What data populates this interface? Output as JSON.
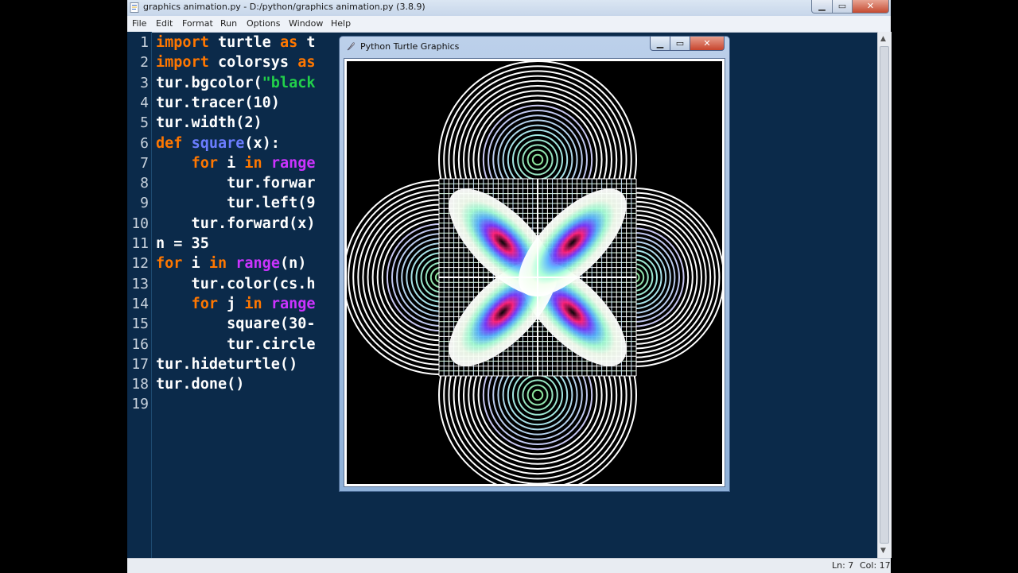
{
  "idle_window": {
    "title": "graphics animation.py - D:/python/graphics animation.py (3.8.9)",
    "menu": [
      "File",
      "Edit",
      "Format",
      "Run",
      "Options",
      "Window",
      "Help"
    ],
    "line_numbers": [
      "1",
      "2",
      "3",
      "4",
      "5",
      "6",
      "7",
      "8",
      "9",
      "10",
      "11",
      "12",
      "13",
      "14",
      "15",
      "16",
      "17",
      "18",
      "19"
    ],
    "status": {
      "line": "Ln: 7",
      "col": "Col: 17"
    },
    "caption_buttons": {
      "minimize": "▁",
      "maximize": "▭",
      "close": "✕"
    }
  },
  "code_lines": [
    [
      {
        "t": "import",
        "c": "kw"
      },
      {
        "t": " turtle ",
        "c": ""
      },
      {
        "t": "as",
        "c": "kw"
      },
      {
        "t": " t",
        "c": ""
      }
    ],
    [
      {
        "t": "import",
        "c": "kw"
      },
      {
        "t": " colorsys ",
        "c": ""
      },
      {
        "t": "as",
        "c": "kw"
      }
    ],
    [
      {
        "t": "tur.bgcolor(",
        "c": ""
      },
      {
        "t": "\"black",
        "c": "st"
      }
    ],
    [
      {
        "t": "tur.tracer(10)",
        "c": ""
      }
    ],
    [
      {
        "t": "tur.width(2)",
        "c": ""
      }
    ],
    [
      {
        "t": "def",
        "c": "kw"
      },
      {
        "t": " ",
        "c": ""
      },
      {
        "t": "square",
        "c": "fn"
      },
      {
        "t": "(x):",
        "c": ""
      }
    ],
    [
      {
        "t": "    ",
        "c": ""
      },
      {
        "t": "for",
        "c": "kw"
      },
      {
        "t": " i ",
        "c": ""
      },
      {
        "t": "in",
        "c": "kw"
      },
      {
        "t": " ",
        "c": ""
      },
      {
        "t": "range",
        "c": "bi"
      }
    ],
    [
      {
        "t": "        tur.forwar",
        "c": ""
      }
    ],
    [
      {
        "t": "        tur.left(9",
        "c": ""
      }
    ],
    [
      {
        "t": "    tur.forward(x)",
        "c": ""
      }
    ],
    [
      {
        "t": "n = 35",
        "c": ""
      }
    ],
    [
      {
        "t": "for",
        "c": "kw"
      },
      {
        "t": " i ",
        "c": ""
      },
      {
        "t": "in",
        "c": "kw"
      },
      {
        "t": " ",
        "c": ""
      },
      {
        "t": "range",
        "c": "bi"
      },
      {
        "t": "(n)",
        "c": ""
      }
    ],
    [
      {
        "t": "    tur.color(cs.h",
        "c": ""
      }
    ],
    [
      {
        "t": "    ",
        "c": ""
      },
      {
        "t": "for",
        "c": "kw"
      },
      {
        "t": " j ",
        "c": ""
      },
      {
        "t": "in",
        "c": "kw"
      },
      {
        "t": " ",
        "c": ""
      },
      {
        "t": "range",
        "c": "bi"
      }
    ],
    [
      {
        "t": "        square(30-",
        "c": ""
      }
    ],
    [
      {
        "t": "        tur.circle",
        "c": ""
      }
    ],
    [
      {
        "t": "tur.hideturtle()",
        "c": ""
      }
    ],
    [
      {
        "t": "tur.done()",
        "c": ""
      }
    ],
    []
  ],
  "turtle_window": {
    "title": "Python Turtle Graphics",
    "buttons": {
      "minimize": "▁",
      "maximize": "▭",
      "close": "✕"
    }
  },
  "colors": {
    "editor_bg": "#0b2a4a",
    "keyword": "#ff7700",
    "builtin": "#cc33ff",
    "def_name": "#6b7dff",
    "string": "#22d14a",
    "code_text": "#ffffff",
    "canvas_bg": "#000000"
  }
}
